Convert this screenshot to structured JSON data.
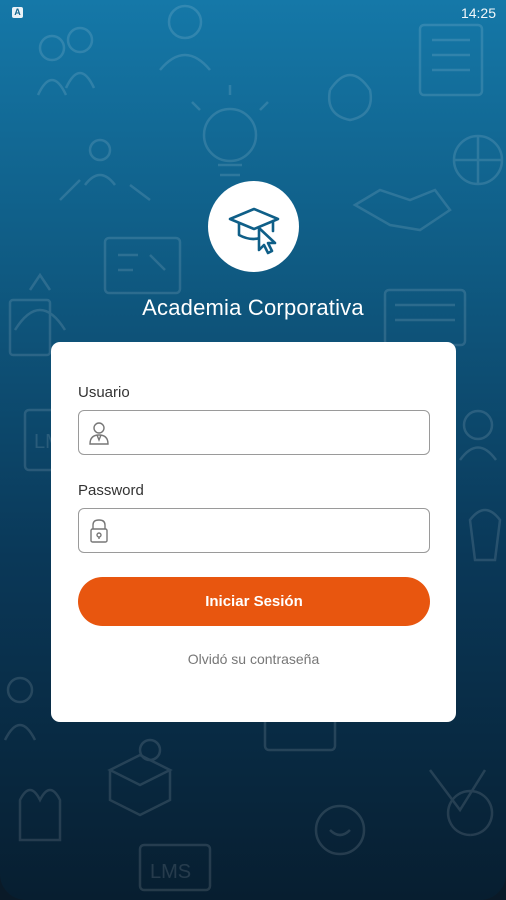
{
  "status_bar": {
    "time": "14:25",
    "notification_icon": "A"
  },
  "app": {
    "title": "Academia Corporativa",
    "logo_icon": "graduation-cap-cursor-icon"
  },
  "form": {
    "username_label": "Usuario",
    "username_value": "",
    "password_label": "Password",
    "password_value": "",
    "login_button": "Iniciar Sesión",
    "forgot_password": "Olvidó su contraseña"
  },
  "colors": {
    "gradient_top": "#1578a8",
    "gradient_bottom": "#071e30",
    "accent_button": "#e8560f",
    "logo_icon": "#0f5f88"
  },
  "background_doodles": {
    "lettering": [
      "LMS",
      "LMS"
    ]
  }
}
